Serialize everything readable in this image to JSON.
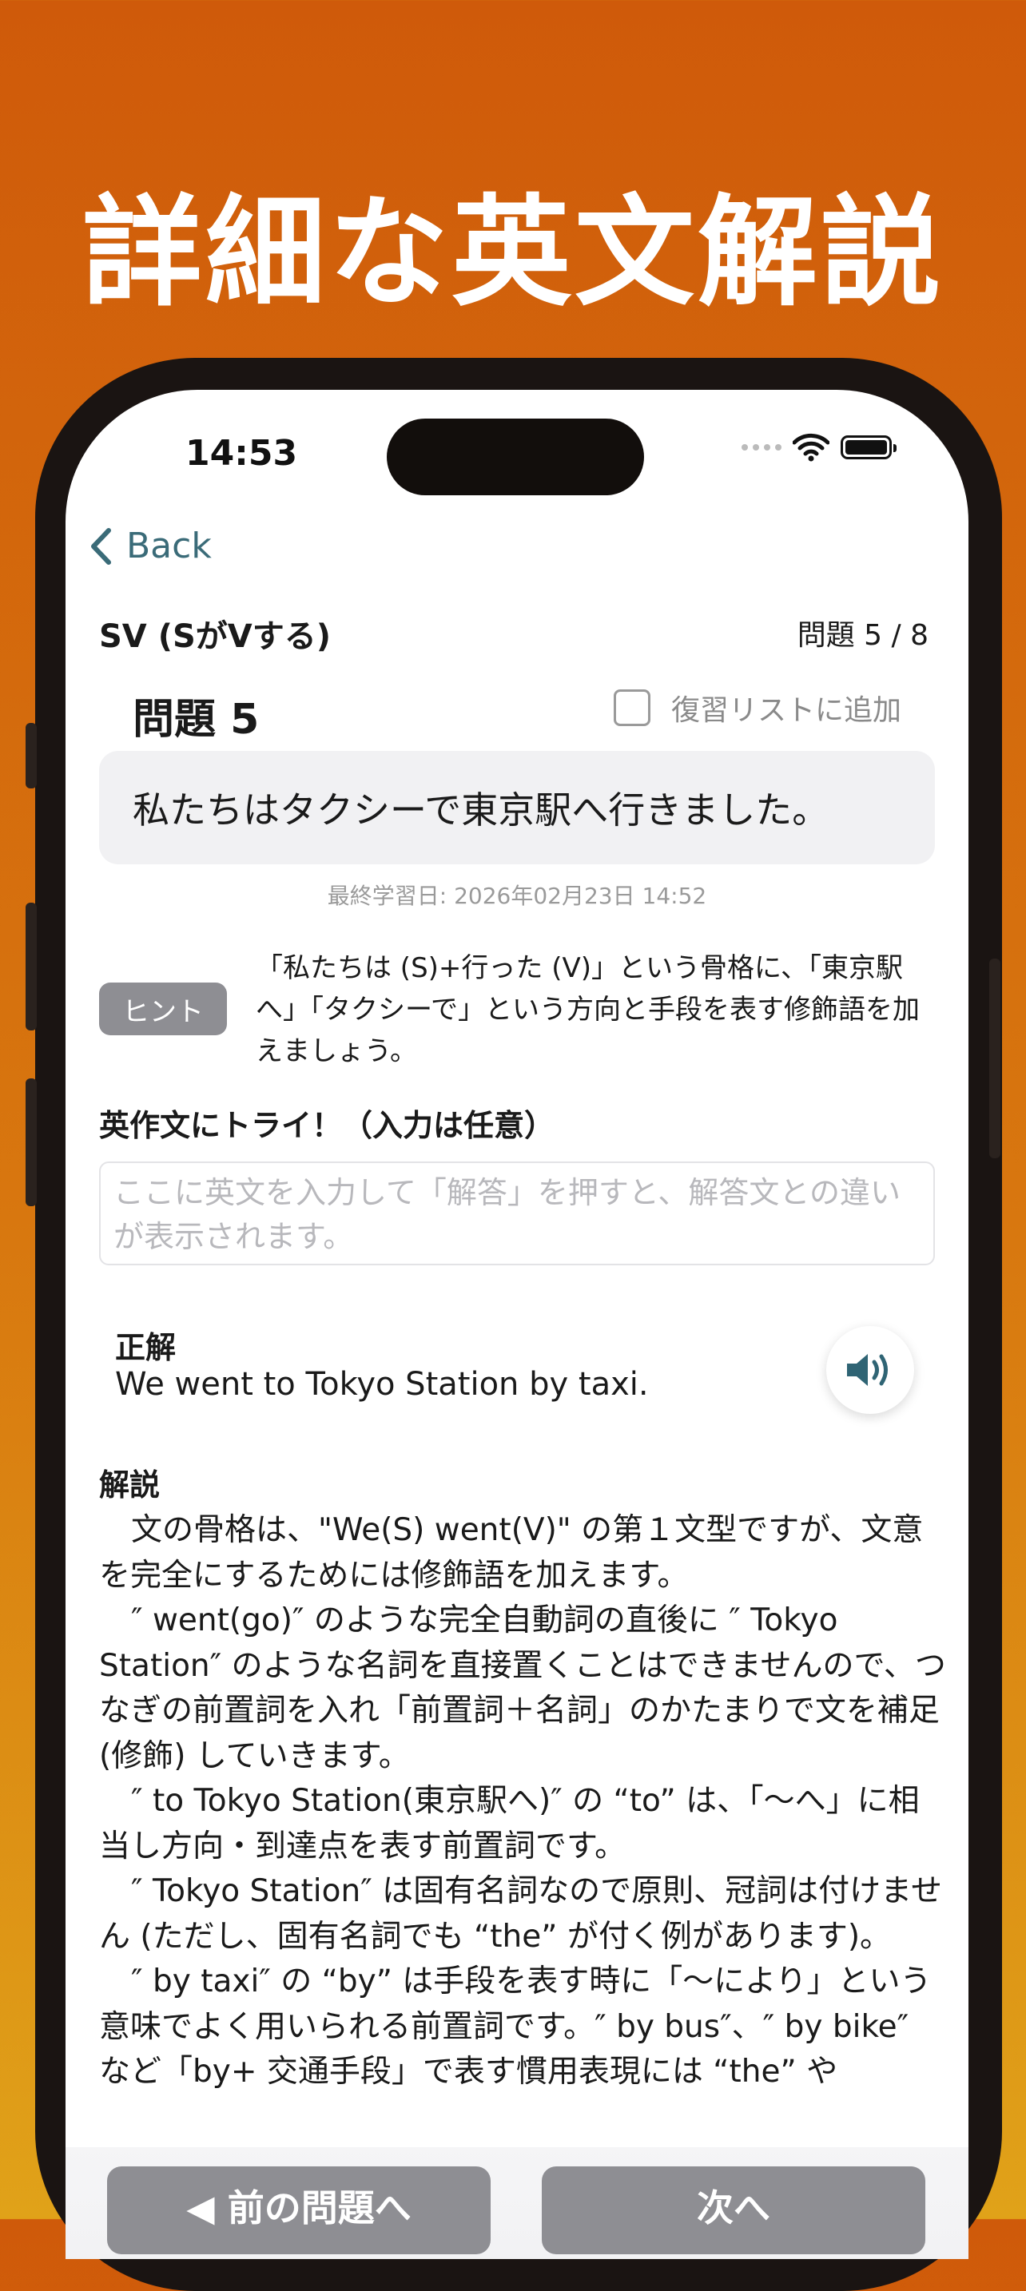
{
  "headline": "詳細な英文解説",
  "status_bar": {
    "time": "14:53"
  },
  "nav": {
    "back_label": "Back"
  },
  "header": {
    "section_title": "SV (SがVする)",
    "progress": "問題 5 / 8"
  },
  "question": {
    "title": "問題 5",
    "review_label": "復習リストに追加",
    "review_checked": false,
    "japanese": "私たちはタクシーで東京駅へ行きました。",
    "last_study": "最終学習日: 2026年02月23日 14:52"
  },
  "hint": {
    "badge": "ヒント",
    "text": "「私たちは (S)+行った (V)」という骨格に、「東京駅へ」「タクシーで」という方向と手段を表す修飾語を加えましょう。"
  },
  "try": {
    "label": "英作文にトライ！（入力は任意）",
    "placeholder": "ここに英文を入力して「解答」を押すと、解答文との違いが表示されます。",
    "value": ""
  },
  "answer": {
    "label": "正解",
    "text": "We went to Tokyo Station by taxi.",
    "speaker_icon": "speaker-icon"
  },
  "explanation": {
    "label": "解説",
    "paragraphs": [
      "文の骨格は、\"We(S) went(V)\" の第１文型ですが、文意を完全にするためには修飾語を加えます。",
      "″ went(go)″ のような完全自動詞の直後に ″ Tokyo Station″ のような名詞を直接置くことはできませんので、つなぎの前置詞を入れ「前置詞＋名詞」のかたまりで文を補足 (修飾) していきます。",
      "″ to Tokyo Station(東京駅へ)″ の “to” は、「〜へ」に相当し方向・到達点を表す前置詞です。",
      "″ Tokyo Station″ は固有名詞なので原則、冠詞は付けません (ただし、固有名詞でも “the” が付く例があります)。",
      "″ by taxi″ の “by” は手段を表す時に「〜により」という意味でよく用いられる前置詞です。″ by bus″、″ by bike″ など「by+ 交通手段」で表す慣用表現には “the” や"
    ]
  },
  "footer": {
    "prev_label": "◀ 前の問題へ",
    "next_label": "次へ"
  },
  "colors": {
    "background_top": "#cf5a0a",
    "background_bottom": "#e0a219",
    "accent": "#3a6b78",
    "button_gray": "#8e8e93"
  }
}
